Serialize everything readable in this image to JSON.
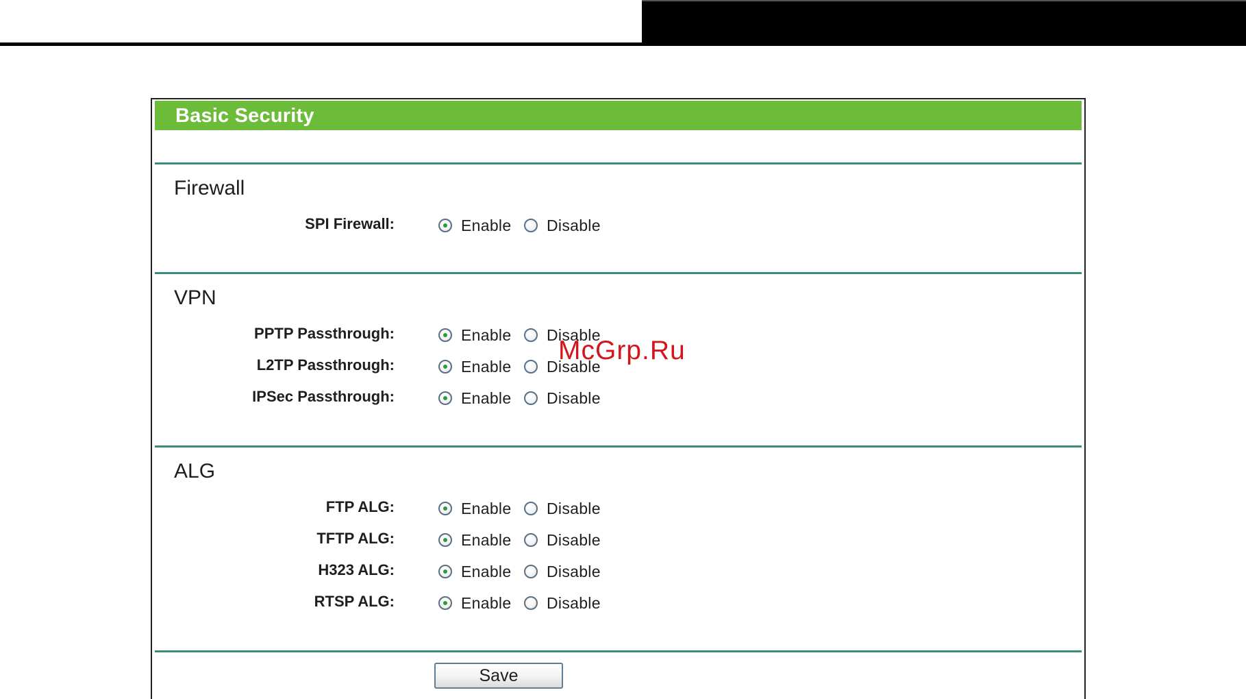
{
  "panel": {
    "title": "Basic Security"
  },
  "options": {
    "enable_label": "Enable",
    "disable_label": "Disable"
  },
  "sections": {
    "firewall": {
      "title": "Firewall",
      "rows": [
        {
          "label": "SPI Firewall:",
          "value": "Enable"
        }
      ]
    },
    "vpn": {
      "title": "VPN",
      "rows": [
        {
          "label": "PPTP Passthrough:",
          "value": "Enable"
        },
        {
          "label": "L2TP Passthrough:",
          "value": "Enable"
        },
        {
          "label": "IPSec Passthrough:",
          "value": "Enable"
        }
      ]
    },
    "alg": {
      "title": "ALG",
      "rows": [
        {
          "label": "FTP ALG:",
          "value": "Enable"
        },
        {
          "label": "TFTP ALG:",
          "value": "Enable"
        },
        {
          "label": "H323 ALG:",
          "value": "Enable"
        },
        {
          "label": "RTSP ALG:",
          "value": "Enable"
        }
      ]
    }
  },
  "save_label": "Save",
  "watermark": "McGrp.Ru",
  "colors": {
    "header_green": "#6cbc39",
    "divider": "#3d8b7a",
    "radio_dot": "#2c9b3a",
    "watermark_red": "#d5141b"
  }
}
